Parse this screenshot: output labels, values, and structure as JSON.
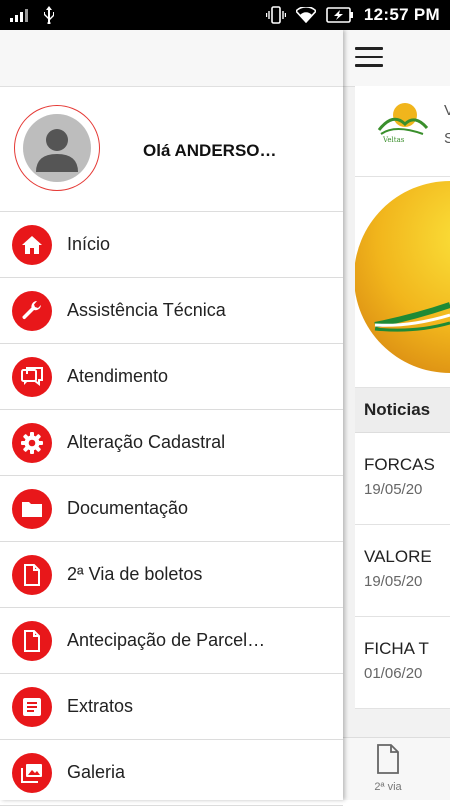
{
  "status_bar": {
    "time": "12:57 PM"
  },
  "drawer": {
    "greeting": "Olá ANDERSO…",
    "menu": [
      {
        "label": "Início",
        "icon": "home-icon"
      },
      {
        "label": "Assistência Técnica",
        "icon": "wrench-icon"
      },
      {
        "label": "Atendimento",
        "icon": "chat-icon"
      },
      {
        "label": "Alteração Cadastral",
        "icon": "gear-icon"
      },
      {
        "label": "Documentação",
        "icon": "folder-icon"
      },
      {
        "label": "2ª Via de boletos",
        "icon": "document-icon"
      },
      {
        "label": "Antecipação de Parcel…",
        "icon": "document-icon"
      },
      {
        "label": "Extratos",
        "icon": "list-icon"
      },
      {
        "label": "Galeria",
        "icon": "gallery-icon"
      }
    ]
  },
  "background_app": {
    "header_text": "V",
    "header_text_2": "S",
    "news_title": "Noticias",
    "news": [
      {
        "title": "FORCAS",
        "date": "19/05/20"
      },
      {
        "title": "VALORE",
        "date": "19/05/20"
      },
      {
        "title": "FICHA T",
        "date": "01/06/20"
      }
    ],
    "bottom_tab_label": "2ª via"
  },
  "colors": {
    "accent": "#e8171a"
  }
}
